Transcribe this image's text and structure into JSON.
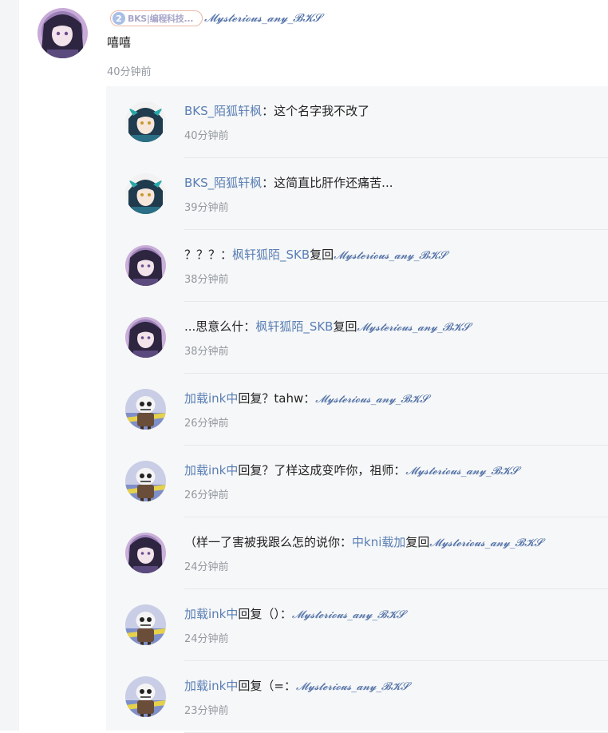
{
  "root_comment": {
    "badge": {
      "level": "2",
      "text": "BKS|编程科技..."
    },
    "author": "𝓜𝔂𝓼𝓽𝓮𝓻𝓲𝓸𝓾𝓼_𝓪𝓷𝔂_𝓑𝓚𝓢",
    "text": "嘻嘻",
    "time": "40分钟前"
  },
  "replies": [
    {
      "avatar": "blue-hair",
      "name": "BKS_陌狐轩枫",
      "sep": "：",
      "text": "这个名字我不改了",
      "time": "40分钟前"
    },
    {
      "avatar": "blue-hair",
      "name": "BKS_陌狐轩枫",
      "sep": "：",
      "text": "这简直比肝作还痛苦...",
      "time": "39分钟前"
    },
    {
      "avatar": "purple-girl",
      "pre": "？？？：",
      "name": "枫轩狐陌_SKB",
      "mid": "复回",
      "fancy": "𝓜𝔂𝓼𝓽𝓮𝓻𝓲𝓸𝓾𝓼_𝓪𝓷𝔂_𝓑𝓚𝓢",
      "time": "38分钟前"
    },
    {
      "avatar": "purple-girl",
      "pre": "...思意么什：",
      "name": "枫轩狐陌_SKB",
      "mid": "复回",
      "fancy": "𝓜𝔂𝓼𝓽𝓮𝓻𝓲𝓸𝓾𝓼_𝓪𝓷𝔂_𝓑𝓚𝓢",
      "time": "38分钟前"
    },
    {
      "avatar": "skull-kid",
      "name": "加载ink中",
      "text": "回复？tahw：",
      "fancy": "𝓜𝔂𝓼𝓽𝓮𝓻𝓲𝓸𝓾𝓼_𝓪𝓷𝔂_𝓑𝓚𝓢",
      "time": "26分钟前"
    },
    {
      "avatar": "skull-kid",
      "name": "加载ink中",
      "text": "回复？了样这成变咋你，祖师：",
      "fancy": "𝓜𝔂𝓼𝓽𝓮𝓻𝓲𝓸𝓾𝓼_𝓪𝓷𝔂_𝓑𝓚𝓢",
      "time": "26分钟前"
    },
    {
      "avatar": "purple-girl",
      "pre": "（样一了害被我跟么怎的说你：",
      "name": "中kni载加",
      "mid": "复回",
      "fancy": "𝓜𝔂𝓼𝓽𝓮𝓻𝓲𝓸𝓾𝓼_𝓪𝓷𝔂_𝓑𝓚𝓢",
      "time": "24分钟前"
    },
    {
      "avatar": "skull-kid",
      "name": "加载ink中",
      "text": "回复（）：",
      "fancy": "𝓜𝔂𝓼𝓽𝓮𝓻𝓲𝓸𝓾𝓼_𝓪𝓷𝔂_𝓑𝓚𝓢",
      "time": "24分钟前"
    },
    {
      "avatar": "skull-kid",
      "name": "加载ink中",
      "text": "回复（=：",
      "fancy": "𝓜𝔂𝓼𝓽𝓮𝓻𝓲𝓸𝓾𝓼_𝓪𝓷𝔂_𝓑𝓚𝓢",
      "time": "23分钟前"
    }
  ],
  "colors": {
    "username": "#5a7fb5",
    "fancy_name": "#4f6fa6",
    "timestamp": "#9499a0",
    "reply_background": "#f6f7f8",
    "badge_border": "#e9b7a6"
  }
}
